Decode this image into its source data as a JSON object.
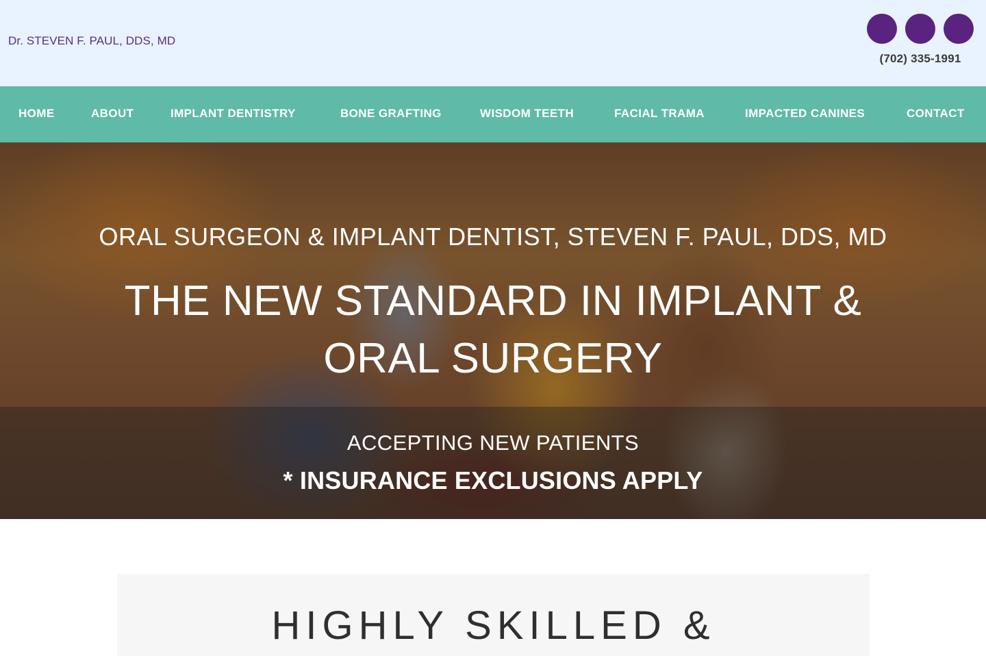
{
  "header": {
    "brand": "Dr. STEVEN F. PAUL, DDS, MD",
    "phone": "(702) 335-1991",
    "social_icons": [
      "social-icon-1",
      "social-icon-2",
      "social-icon-3"
    ]
  },
  "nav": {
    "items": [
      {
        "label": "HOME"
      },
      {
        "label": "ABOUT"
      },
      {
        "label": "IMPLANT DENTISTRY"
      },
      {
        "label": "BONE GRAFTING"
      },
      {
        "label": "WISDOM TEETH"
      },
      {
        "label": "FACIAL TRAMA"
      },
      {
        "label": "IMPACTED CANINES"
      },
      {
        "label": "CONTACT"
      }
    ]
  },
  "hero": {
    "subtitle": "ORAL SURGEON & IMPLANT DENTIST, STEVEN F. PAUL, DDS, MD",
    "title_line1": "THE NEW STANDARD IN IMPLANT &",
    "title_line2": "ORAL SURGERY",
    "band_line1": "ACCEPTING NEW PATIENTS",
    "band_line2": "* INSURANCE EXCLUSIONS APPLY"
  },
  "section": {
    "heading": "HIGHLY SKILLED &"
  },
  "colors": {
    "header_bg": "#e8f3ff",
    "brand_purple": "#5a2380",
    "nav_teal": "#5fbaa7"
  }
}
